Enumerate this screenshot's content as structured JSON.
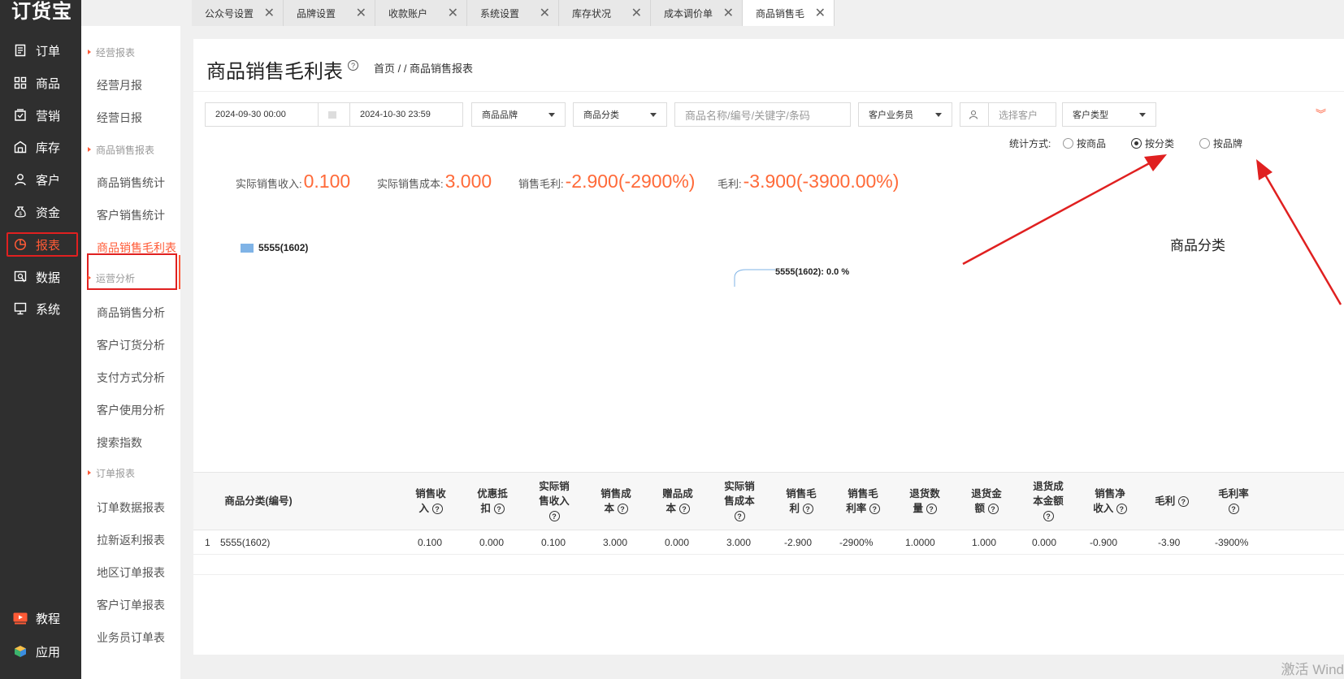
{
  "app": {
    "logo": "订货宝"
  },
  "main_nav": [
    {
      "label": "订单",
      "icon": "order-icon"
    },
    {
      "label": "商品",
      "icon": "goods-icon"
    },
    {
      "label": "营销",
      "icon": "marketing-icon"
    },
    {
      "label": "库存",
      "icon": "inventory-icon"
    },
    {
      "label": "客户",
      "icon": "customer-icon"
    },
    {
      "label": "资金",
      "icon": "money-bag-icon"
    },
    {
      "label": "报表",
      "icon": "pie-chart-icon",
      "active": true
    },
    {
      "label": "数据",
      "icon": "data-icon"
    },
    {
      "label": "系统",
      "icon": "monitor-icon"
    }
  ],
  "bottom_nav": [
    {
      "label": "教程",
      "icon": "play-video-icon"
    },
    {
      "label": "应用",
      "icon": "cube-icon"
    }
  ],
  "sub_nav": {
    "groups": [
      "经营报表",
      "商品销售报表",
      "运营分析",
      "订单报表"
    ],
    "items": [
      "经营月报",
      "经营日报",
      "商品销售统计",
      "客户销售统计",
      "商品销售毛利表",
      "商品销售分析",
      "客户订货分析",
      "支付方式分析",
      "客户使用分析",
      "搜索指数",
      "订单数据报表",
      "拉新返利报表",
      "地区订单报表",
      "客户订单报表",
      "业务员订单表"
    ]
  },
  "tabs": [
    "公众号设置",
    "品牌设置",
    "收款账户",
    "系统设置",
    "库存状况",
    "成本调价单",
    "商品销售毛"
  ],
  "page": {
    "title": "商品销售毛利表",
    "breadcrumb": "首页 / / 商品销售报表"
  },
  "filters": {
    "start_date": "2024-09-30 00:00",
    "end_date": "2024-10-30 23:59",
    "brand": "商品品牌",
    "category": "商品分类",
    "keyword_placeholder": "商品名称/编号/关键字/条码",
    "salesperson": "客户业务员",
    "customer_placeholder": "选择客户",
    "customer_type": "客户类型"
  },
  "stat_mode": {
    "label": "统计方式:",
    "options": [
      "按商品",
      "按分类",
      "按品牌"
    ],
    "selected": "按分类"
  },
  "summary": {
    "revenue_label": "实际销售收入:",
    "revenue": "0.100",
    "cost_label": "实际销售成本:",
    "cost": "3.000",
    "gross_label": "销售毛利:",
    "gross": "-2.900(-2900%)",
    "profit_label": "毛利:",
    "profit": "-3.900(-3900.00%)"
  },
  "chart": {
    "legend": "5555(1602)",
    "slice_label": "5555(1602): 0.0 %",
    "legend_color": "#7fb3e6"
  },
  "chart_data": {
    "type": "pie",
    "categories": [
      "5555(1602)"
    ],
    "values": [
      0.0
    ]
  },
  "annotation": {
    "note": "商品分类"
  },
  "table": {
    "headers": [
      [
        "商品分类(编号)"
      ],
      [
        "销售收",
        "入"
      ],
      [
        "优惠抵",
        "扣"
      ],
      [
        "实际销",
        "售收入"
      ],
      [
        "销售成",
        "本"
      ],
      [
        "赠品成",
        "本"
      ],
      [
        "实际销",
        "售成本"
      ],
      [
        "销售毛",
        "利"
      ],
      [
        "销售毛",
        "利率"
      ],
      [
        "退货数",
        "量"
      ],
      [
        "退货金",
        "额"
      ],
      [
        "退货成",
        "本金额"
      ],
      [
        "销售净",
        "收入"
      ],
      [
        "毛利"
      ],
      [
        "毛利率"
      ]
    ],
    "rows": [
      [
        "1",
        "5555(1602)",
        "0.100",
        "0.000",
        "0.100",
        "3.000",
        "0.000",
        "3.000",
        "-2.900",
        "-2900%",
        "1.0000",
        "1.000",
        "0.000",
        "-0.900",
        "-3.90",
        "-3900%"
      ]
    ]
  },
  "watermark": "激活 Wind",
  "colors": {
    "accent": "#ff5a36",
    "highlight_box": "#e02020",
    "sidebar": "#2f2f2f",
    "value_orange": "#ff6a39"
  }
}
